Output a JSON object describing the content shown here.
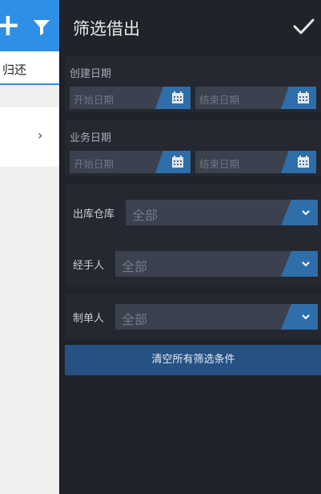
{
  "background_page": {
    "tab_label": "归还"
  },
  "panel": {
    "title": "筛选借出",
    "create_date": {
      "label": "创建日期",
      "start_placeholder": "开始日期",
      "end_placeholder": "结束日期"
    },
    "business_date": {
      "label": "业务日期",
      "start_placeholder": "开始日期",
      "end_placeholder": "结束日期"
    },
    "warehouse": {
      "label": "出库仓库",
      "value": "全部"
    },
    "handler": {
      "label": "经手人",
      "value": "全部"
    },
    "creator": {
      "label": "制单人",
      "value": "全部"
    },
    "clear_label": "清空所有筛选条件"
  },
  "colors": {
    "header_blue": "#2f8fe6",
    "panel_bg": "#1f2229",
    "accent": "#2e6eaa",
    "clear_button": "#255183"
  }
}
